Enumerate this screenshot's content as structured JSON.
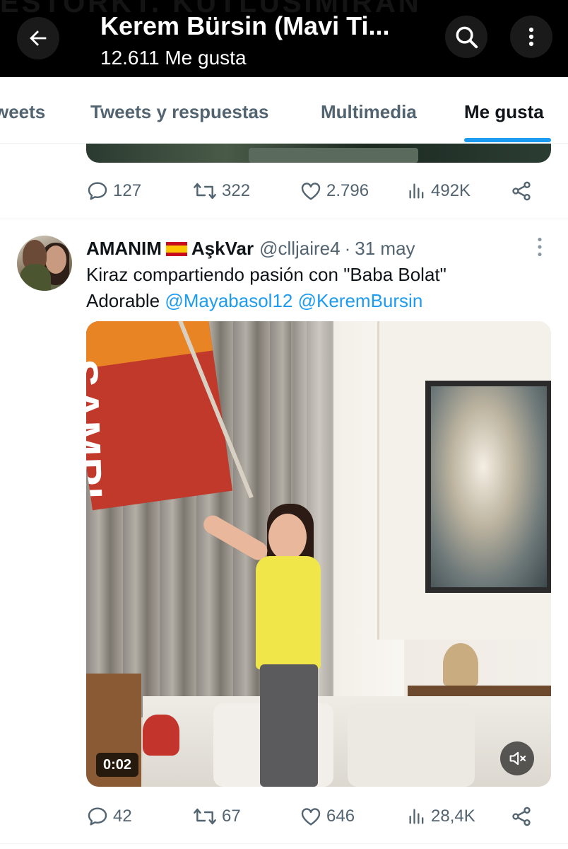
{
  "header": {
    "background_text": "ESTORKT. KUTLUSIMIRAN",
    "title": "Kerem Bürsin (Mavi Ti...",
    "subtitle": "12.611 Me gusta",
    "icons": {
      "back": "arrow-left-icon",
      "search": "search-icon",
      "more": "more-vertical-icon"
    }
  },
  "tabs": [
    {
      "label": "weets",
      "active": false
    },
    {
      "label": "Tweets y respuestas",
      "active": false
    },
    {
      "label": "Multimedia",
      "active": false
    },
    {
      "label": "Me gusta",
      "active": true
    }
  ],
  "previous_tweet": {
    "replies": "127",
    "retweets": "322",
    "likes": "2.796",
    "views": "492K"
  },
  "tweet": {
    "author_name": "AMANIM",
    "flag": "🇪🇸",
    "author_name_suffix": "AşkVar",
    "handle": "@clljaire4",
    "separator": "·",
    "date": "31 may",
    "text_line1": "Kiraz compartiendo pasión con \"Baba Bolat\"",
    "text_prefix": "Adorable",
    "mention1": "@Mayabasol12",
    "mention2": "@KeremBursin",
    "video": {
      "flag_text": "SAMPI",
      "duration": "0:02",
      "mute_icon": "volume-muted-icon"
    },
    "replies": "42",
    "retweets": "67",
    "likes": "646",
    "views": "28,4K"
  },
  "colors": {
    "accent": "#1d9bf0",
    "text_primary": "#0f1419",
    "text_secondary": "#536471",
    "header_bg": "#000000"
  }
}
